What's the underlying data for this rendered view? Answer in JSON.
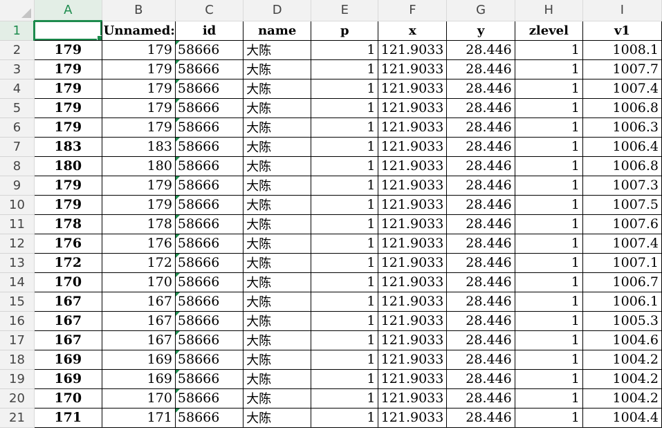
{
  "columns": [
    "A",
    "B",
    "C",
    "D",
    "E",
    "F",
    "G",
    "H",
    "I"
  ],
  "header_row": {
    "row_number": "1",
    "cells": [
      "",
      "Unnamed:",
      "id",
      "name",
      "p",
      "x",
      "y",
      "zlevel",
      "v1"
    ]
  },
  "rows": [
    {
      "n": "2",
      "a": "179",
      "b": "179",
      "c": "58666",
      "d": "大陈",
      "e": "1",
      "f": "121.9033",
      "g": "28.446",
      "h": "1",
      "i": "1008.1"
    },
    {
      "n": "3",
      "a": "179",
      "b": "179",
      "c": "58666",
      "d": "大陈",
      "e": "1",
      "f": "121.9033",
      "g": "28.446",
      "h": "1",
      "i": "1007.7"
    },
    {
      "n": "4",
      "a": "179",
      "b": "179",
      "c": "58666",
      "d": "大陈",
      "e": "1",
      "f": "121.9033",
      "g": "28.446",
      "h": "1",
      "i": "1007.4"
    },
    {
      "n": "5",
      "a": "179",
      "b": "179",
      "c": "58666",
      "d": "大陈",
      "e": "1",
      "f": "121.9033",
      "g": "28.446",
      "h": "1",
      "i": "1006.8"
    },
    {
      "n": "6",
      "a": "179",
      "b": "179",
      "c": "58666",
      "d": "大陈",
      "e": "1",
      "f": "121.9033",
      "g": "28.446",
      "h": "1",
      "i": "1006.3"
    },
    {
      "n": "7",
      "a": "183",
      "b": "183",
      "c": "58666",
      "d": "大陈",
      "e": "1",
      "f": "121.9033",
      "g": "28.446",
      "h": "1",
      "i": "1006.4"
    },
    {
      "n": "8",
      "a": "180",
      "b": "180",
      "c": "58666",
      "d": "大陈",
      "e": "1",
      "f": "121.9033",
      "g": "28.446",
      "h": "1",
      "i": "1006.8"
    },
    {
      "n": "9",
      "a": "179",
      "b": "179",
      "c": "58666",
      "d": "大陈",
      "e": "1",
      "f": "121.9033",
      "g": "28.446",
      "h": "1",
      "i": "1007.3"
    },
    {
      "n": "10",
      "a": "179",
      "b": "179",
      "c": "58666",
      "d": "大陈",
      "e": "1",
      "f": "121.9033",
      "g": "28.446",
      "h": "1",
      "i": "1007.5"
    },
    {
      "n": "11",
      "a": "178",
      "b": "178",
      "c": "58666",
      "d": "大陈",
      "e": "1",
      "f": "121.9033",
      "g": "28.446",
      "h": "1",
      "i": "1007.6"
    },
    {
      "n": "12",
      "a": "176",
      "b": "176",
      "c": "58666",
      "d": "大陈",
      "e": "1",
      "f": "121.9033",
      "g": "28.446",
      "h": "1",
      "i": "1007.4"
    },
    {
      "n": "13",
      "a": "172",
      "b": "172",
      "c": "58666",
      "d": "大陈",
      "e": "1",
      "f": "121.9033",
      "g": "28.446",
      "h": "1",
      "i": "1007.1"
    },
    {
      "n": "14",
      "a": "170",
      "b": "170",
      "c": "58666",
      "d": "大陈",
      "e": "1",
      "f": "121.9033",
      "g": "28.446",
      "h": "1",
      "i": "1006.7"
    },
    {
      "n": "15",
      "a": "167",
      "b": "167",
      "c": "58666",
      "d": "大陈",
      "e": "1",
      "f": "121.9033",
      "g": "28.446",
      "h": "1",
      "i": "1006.1"
    },
    {
      "n": "16",
      "a": "167",
      "b": "167",
      "c": "58666",
      "d": "大陈",
      "e": "1",
      "f": "121.9033",
      "g": "28.446",
      "h": "1",
      "i": "1005.3"
    },
    {
      "n": "17",
      "a": "167",
      "b": "167",
      "c": "58666",
      "d": "大陈",
      "e": "1",
      "f": "121.9033",
      "g": "28.446",
      "h": "1",
      "i": "1004.6"
    },
    {
      "n": "18",
      "a": "169",
      "b": "169",
      "c": "58666",
      "d": "大陈",
      "e": "1",
      "f": "121.9033",
      "g": "28.446",
      "h": "1",
      "i": "1004.2"
    },
    {
      "n": "19",
      "a": "169",
      "b": "169",
      "c": "58666",
      "d": "大陈",
      "e": "1",
      "f": "121.9033",
      "g": "28.446",
      "h": "1",
      "i": "1004.2"
    },
    {
      "n": "20",
      "a": "170",
      "b": "170",
      "c": "58666",
      "d": "大陈",
      "e": "1",
      "f": "121.9033",
      "g": "28.446",
      "h": "1",
      "i": "1004.2"
    },
    {
      "n": "21",
      "a": "171",
      "b": "171",
      "c": "58666",
      "d": "大陈",
      "e": "1",
      "f": "121.9033",
      "g": "28.446",
      "h": "1",
      "i": "1004.4"
    }
  ],
  "colors": {
    "accent": "#1e8c4e",
    "header_bg": "#f2f2f2",
    "selected_header_bg": "#e3eee6"
  }
}
